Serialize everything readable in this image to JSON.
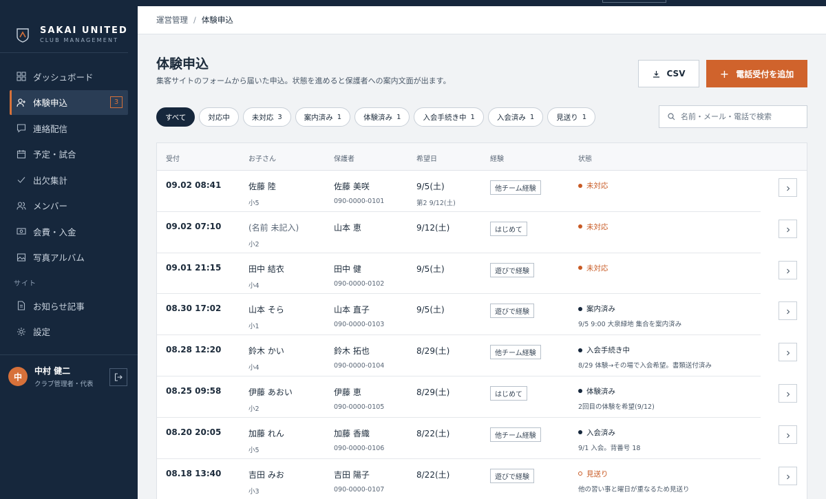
{
  "brand": {
    "name": "SAKAI UNITED",
    "sub": "CLUB MANAGEMENT"
  },
  "sidebar": {
    "items": [
      {
        "label": "ダッシュボード",
        "icon": "grid-icon"
      },
      {
        "label": "体験申込",
        "icon": "user-plus-icon",
        "badge": "3",
        "active": true
      },
      {
        "label": "連絡配信",
        "icon": "chat-icon"
      },
      {
        "label": "予定・試合",
        "icon": "calendar-icon"
      },
      {
        "label": "出欠集計",
        "icon": "check-icon"
      },
      {
        "label": "メンバー",
        "icon": "users-icon"
      },
      {
        "label": "会費・入金",
        "icon": "money-icon"
      },
      {
        "label": "写真アルバム",
        "icon": "image-icon"
      }
    ],
    "section_label": "サイト",
    "site_items": [
      {
        "label": "お知らせ記事",
        "icon": "document-icon"
      },
      {
        "label": "設定",
        "icon": "gear-icon"
      }
    ],
    "user": {
      "initial": "中",
      "name": "中村 健二",
      "role": "クラブ管理者・代表"
    }
  },
  "breadcrumb": {
    "parent": "運営管理",
    "sep": "/",
    "current": "体験申込"
  },
  "header": {
    "title": "体験申込",
    "description": "集客サイトのフォームから届いた申込。状態を進めると保護者への案内文面が出ます。",
    "csv_label": "CSV",
    "add_label": "電話受付を追加"
  },
  "filters": [
    {
      "label": "すべて",
      "count": "",
      "active": true
    },
    {
      "label": "対応中",
      "count": ""
    },
    {
      "label": "未対応",
      "count": "3"
    },
    {
      "label": "案内済み",
      "count": "1"
    },
    {
      "label": "体験済み",
      "count": "1"
    },
    {
      "label": "入会手続き中",
      "count": "1"
    },
    {
      "label": "入会済み",
      "count": "1"
    },
    {
      "label": "見送り",
      "count": "1"
    }
  ],
  "search": {
    "placeholder": "名前・メール・電話で検索"
  },
  "table": {
    "headers": [
      "受付",
      "お子さん",
      "保護者",
      "希望日",
      "経験",
      "状態"
    ],
    "rows": [
      {
        "time": "09.02 08:41",
        "child": "佐藤 陸",
        "grade": "小5",
        "guardian": "佐藤 美咲",
        "phone": "090-0000-0101",
        "date": "9/5(土)",
        "date2": "第2 9/12(土)",
        "exp": "他チーム経験",
        "status": "未対応",
        "tone": "orange",
        "note": ""
      },
      {
        "time": "09.02 07:10",
        "child": "(名前 未記入)",
        "grade": "小2",
        "guardian": "山本 恵",
        "phone": "",
        "date": "9/12(土)",
        "date2": "",
        "exp": "はじめて",
        "status": "未対応",
        "tone": "orange",
        "note": "",
        "muted": true
      },
      {
        "time": "09.01 21:15",
        "child": "田中 結衣",
        "grade": "小4",
        "guardian": "田中 健",
        "phone": "090-0000-0102",
        "date": "9/5(土)",
        "date2": "",
        "exp": "遊びで経験",
        "status": "未対応",
        "tone": "orange",
        "note": ""
      },
      {
        "time": "08.30 17:02",
        "child": "山本 そら",
        "grade": "小1",
        "guardian": "山本 直子",
        "phone": "090-0000-0103",
        "date": "9/5(土)",
        "date2": "",
        "exp": "遊びで経験",
        "status": "案内済み",
        "tone": "navy",
        "note": "9/5 9:00 大泉緑地 集合を案内済み"
      },
      {
        "time": "08.28 12:20",
        "child": "鈴木 かい",
        "grade": "小4",
        "guardian": "鈴木 拓也",
        "phone": "090-0000-0104",
        "date": "8/29(土)",
        "date2": "",
        "exp": "他チーム経験",
        "status": "入会手続き中",
        "tone": "navy",
        "note": "8/29 体験→その場で入会希望。書類送付済み"
      },
      {
        "time": "08.25 09:58",
        "child": "伊藤 あおい",
        "grade": "小2",
        "guardian": "伊藤 恵",
        "phone": "090-0000-0105",
        "date": "8/29(土)",
        "date2": "",
        "exp": "はじめて",
        "status": "体験済み",
        "tone": "navy",
        "note": "2回目の体験を希望(9/12)"
      },
      {
        "time": "08.20 20:05",
        "child": "加藤 れん",
        "grade": "小5",
        "guardian": "加藤 香織",
        "phone": "090-0000-0106",
        "date": "8/22(土)",
        "date2": "",
        "exp": "他チーム経験",
        "status": "入会済み",
        "tone": "navy",
        "note": "9/1 入会。背番号 18"
      },
      {
        "time": "08.18 13:40",
        "child": "吉田 みお",
        "grade": "小3",
        "guardian": "吉田 陽子",
        "phone": "090-0000-0107",
        "date": "8/22(土)",
        "date2": "",
        "exp": "遊びで経験",
        "status": "見送り",
        "tone": "red",
        "note": "他の習い事と曜日が重なるため見送り"
      }
    ]
  }
}
